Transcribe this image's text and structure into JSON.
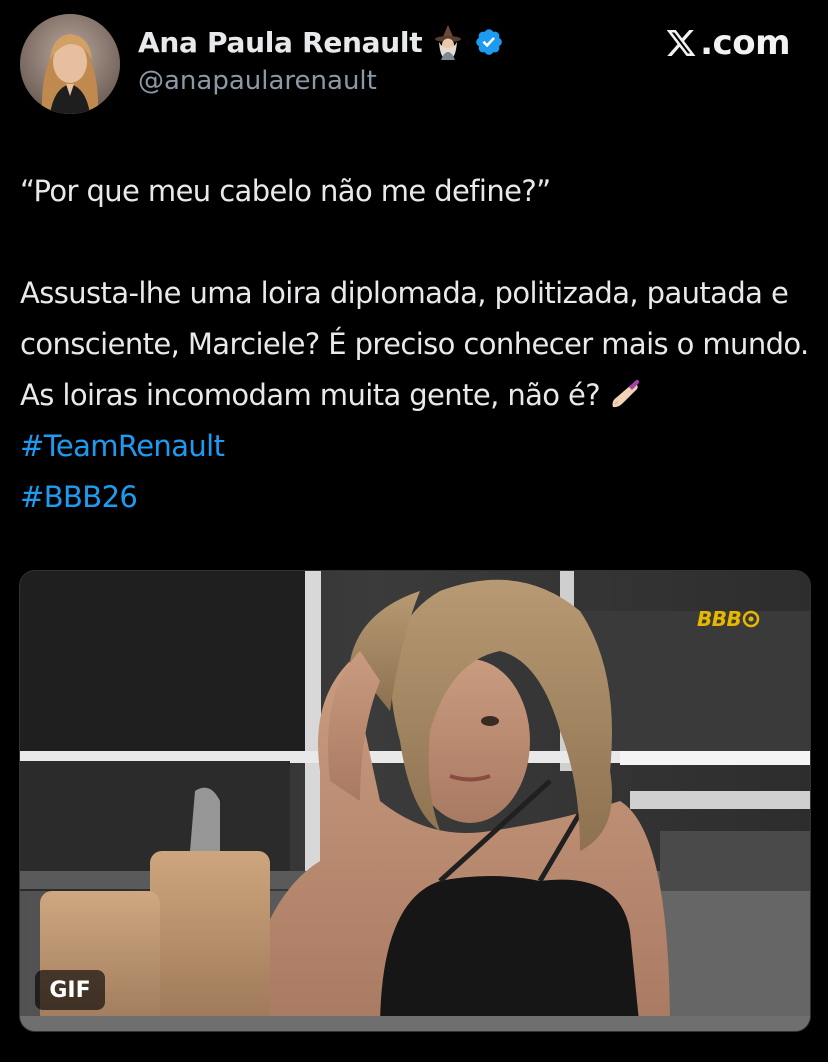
{
  "tweet": {
    "author": {
      "display_name": "Ana Paula Renault",
      "handle": "@anapaularenault",
      "verified": true,
      "emoji_icon": "witch-icon",
      "avatar_icon": "avatar-portrait"
    },
    "brand": {
      "logo_icon": "x-logo-icon",
      "label": ".com"
    },
    "text": {
      "line_quote": "“Por que meu cabelo não me define?”",
      "body": "Assusta-lhe uma loira diplomada, politizada, pautada e consciente, Marciele? É preciso conhecer mais o mundo. As loiras incomodam muita gente, não é?",
      "nails_emoji": "nail-polish-icon",
      "hashtags": [
        "#TeamRenault",
        "#BBB26"
      ]
    },
    "media": {
      "type": "gif",
      "badge_label": "GIF",
      "overlay_logo": "BBB"
    }
  },
  "colors": {
    "background": "#000000",
    "text": "#e7e9ea",
    "secondary": "#8b98a5",
    "link": "#1d9bf0",
    "verified_badge": "#1d9bf0"
  }
}
